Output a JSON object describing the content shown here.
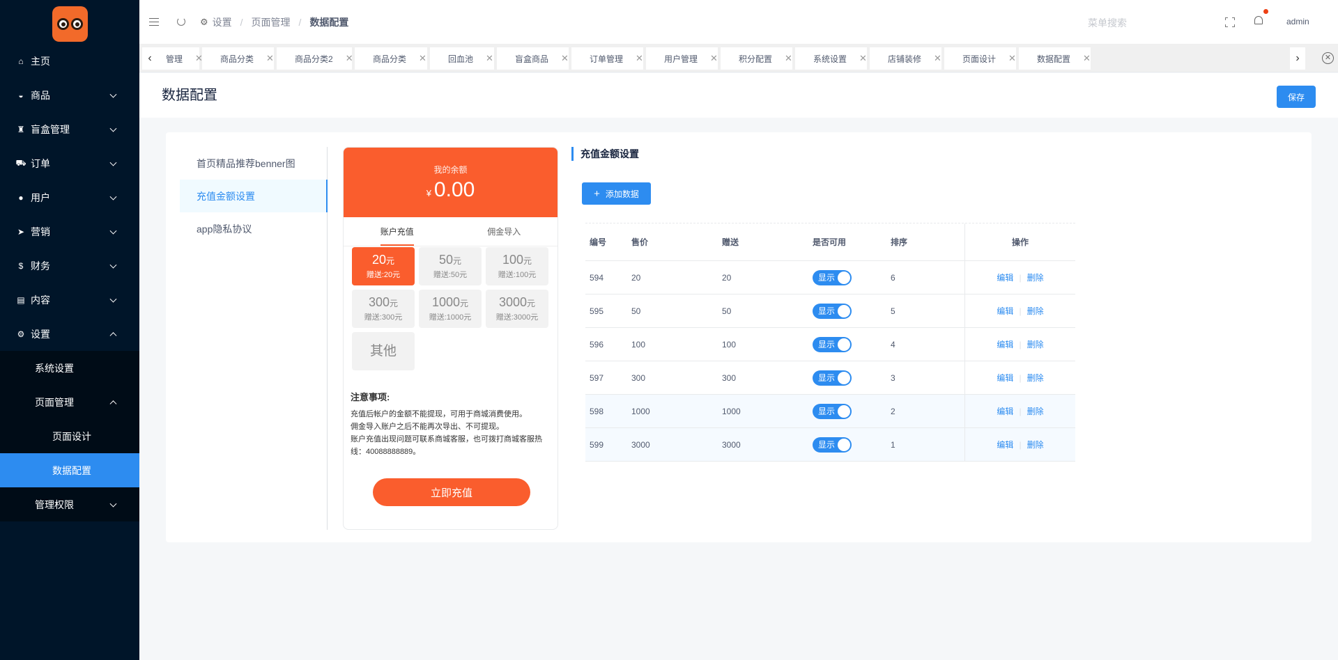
{
  "sidebar": {
    "items": [
      {
        "label": "主页",
        "icon": "home-icon"
      },
      {
        "label": "商品",
        "icon": "basket-icon"
      },
      {
        "label": "盲盒管理",
        "icon": "trophy-icon"
      },
      {
        "label": "订单",
        "icon": "cart-icon"
      },
      {
        "label": "用户",
        "icon": "user-icon"
      },
      {
        "label": "营销",
        "icon": "send-icon"
      },
      {
        "label": "财务",
        "icon": "dollar-icon"
      },
      {
        "label": "内容",
        "icon": "book-icon"
      },
      {
        "label": "设置",
        "icon": "gear-icon"
      }
    ],
    "sub": {
      "system": "系统设置",
      "page": "页面管理",
      "page_design": "页面设计",
      "data_config": "数据配置",
      "permissions": "管理权限"
    }
  },
  "header": {
    "breadcrumb": [
      "设置",
      "页面管理",
      "数据配置"
    ],
    "search_placeholder": "菜单搜索",
    "user": "admin"
  },
  "tabs": [
    {
      "label": "管理",
      "active": false
    },
    {
      "label": "商品分类",
      "active": false
    },
    {
      "label": "商品分类2",
      "active": false
    },
    {
      "label": "商品分类",
      "active": false
    },
    {
      "label": "回血池",
      "active": false
    },
    {
      "label": "盲盒商品",
      "active": false
    },
    {
      "label": "订单管理",
      "active": false
    },
    {
      "label": "用户管理",
      "active": false
    },
    {
      "label": "积分配置",
      "active": false
    },
    {
      "label": "系统设置",
      "active": false
    },
    {
      "label": "店铺装修",
      "active": false
    },
    {
      "label": "页面设计",
      "active": false
    },
    {
      "label": "数据配置",
      "active": true
    }
  ],
  "page": {
    "title": "数据配置",
    "save": "保存"
  },
  "left_menu": [
    "首页精品推荐benner图",
    "充值金额设置",
    "app隐私协议"
  ],
  "phone": {
    "balance_label": "我的余额",
    "currency": "¥",
    "balance": "0.00",
    "tab1": "账户充值",
    "tab2": "佣金导入",
    "amounts": [
      {
        "v": "20",
        "unit": "元",
        "g": "赠送:20元"
      },
      {
        "v": "50",
        "unit": "元",
        "g": "赠送:50元"
      },
      {
        "v": "100",
        "unit": "元",
        "g": "赠送:100元"
      },
      {
        "v": "300",
        "unit": "元",
        "g": "赠送:300元"
      },
      {
        "v": "1000",
        "unit": "元",
        "g": "赠送:1000元"
      },
      {
        "v": "3000",
        "unit": "元",
        "g": "赠送:3000元"
      }
    ],
    "other": "其他",
    "notice_title": "注意事项:",
    "notice": [
      "充值后帐户的金额不能提现，可用于商城消费使用。",
      "佣金导入账户之后不能再次导出、不可提现。",
      "账户充值出现问题可联系商城客服，也可拨打商城客服热线：40088888889。"
    ],
    "button": "立即充值"
  },
  "section": {
    "title": "充值金额设置",
    "add_button": "添加数据",
    "add_plus": "+"
  },
  "table": {
    "headers": [
      "编号",
      "售价",
      "赠送",
      "是否可用",
      "排序",
      "操作"
    ],
    "rows": [
      {
        "id": "594",
        "price": "20",
        "give": "20",
        "status": "显示",
        "sort": "6"
      },
      {
        "id": "595",
        "price": "50",
        "give": "50",
        "status": "显示",
        "sort": "5"
      },
      {
        "id": "596",
        "price": "100",
        "give": "100",
        "status": "显示",
        "sort": "4"
      },
      {
        "id": "597",
        "price": "300",
        "give": "300",
        "status": "显示",
        "sort": "3"
      },
      {
        "id": "598",
        "price": "1000",
        "give": "1000",
        "status": "显示",
        "sort": "2"
      },
      {
        "id": "599",
        "price": "3000",
        "give": "3000",
        "status": "显示",
        "sort": "1"
      }
    ],
    "edit": "编辑",
    "delete": "删除"
  }
}
